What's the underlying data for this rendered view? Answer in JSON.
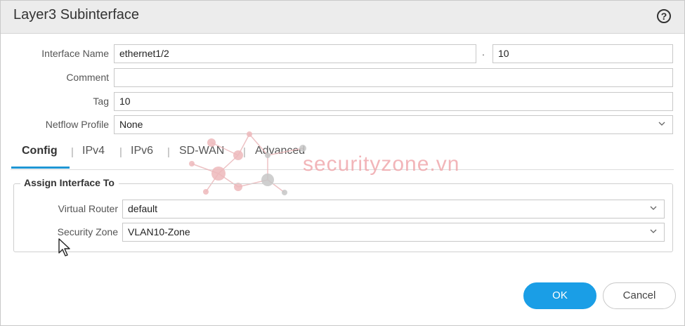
{
  "dialog": {
    "title": "Layer3 Subinterface",
    "help_icon": "question-circle-icon"
  },
  "form": {
    "interface_name_label": "Interface Name",
    "interface_name_value": "ethernet1/2",
    "separator": ".",
    "subinterface_number": "10",
    "comment_label": "Comment",
    "comment_value": "",
    "tag_label": "Tag",
    "tag_value": "10",
    "netflow_label": "Netflow Profile",
    "netflow_value": "None"
  },
  "tabs": [
    {
      "label": "Config",
      "active": true
    },
    {
      "label": "IPv4",
      "active": false
    },
    {
      "label": "IPv6",
      "active": false
    },
    {
      "label": "SD-WAN",
      "active": false
    },
    {
      "label": "Advanced",
      "active": false
    }
  ],
  "assign": {
    "legend": "Assign Interface To",
    "virtual_router_label": "Virtual Router",
    "virtual_router_value": "default",
    "security_zone_label": "Security Zone",
    "security_zone_value": "VLAN10-Zone"
  },
  "watermark": {
    "text": "securityzone.vn"
  },
  "buttons": {
    "ok": "OK",
    "cancel": "Cancel"
  },
  "colors": {
    "accent": "#1a9ee6",
    "tab_underline": "#1f96d4",
    "titlebar": "#ececec",
    "watermark": "#f0a9ad"
  }
}
